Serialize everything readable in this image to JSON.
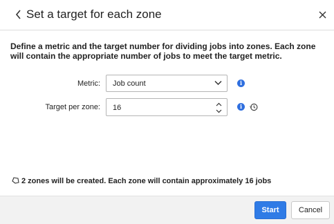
{
  "dialog": {
    "title": "Set a target for each zone",
    "description": "Define a metric and the target number for dividing jobs into zones. Each zone will contain the appropriate number of jobs to meet the target metric."
  },
  "form": {
    "metric_label": "Metric:",
    "metric_value": "Job count",
    "target_label": "Target per zone:",
    "target_value": "16"
  },
  "summary": {
    "text": "2 zones will be created. Each zone will contain approximately 16 jobs"
  },
  "footer": {
    "start_label": "Start",
    "cancel_label": "Cancel"
  },
  "icons": {
    "info": "i",
    "accent_color": "#2f7be6"
  }
}
